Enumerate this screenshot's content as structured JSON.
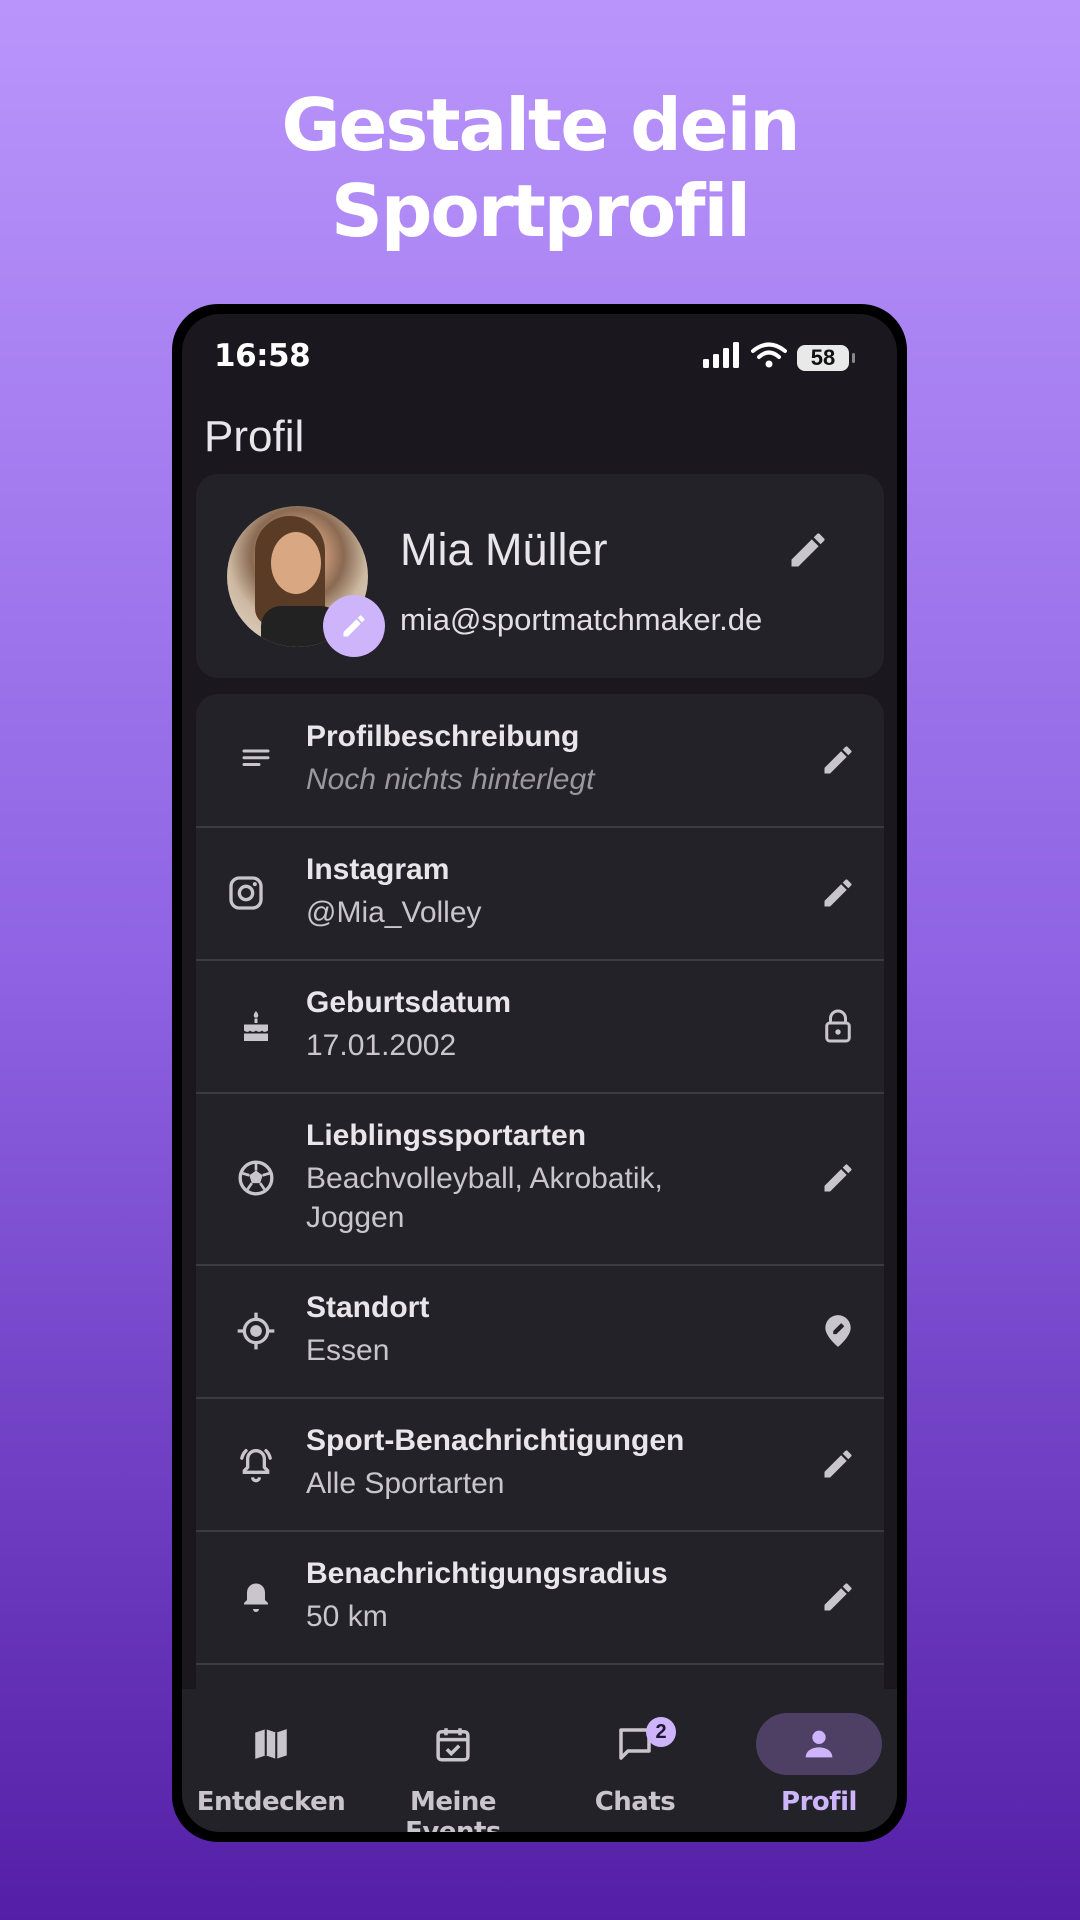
{
  "headline": {
    "line1": "Gestalte dein",
    "line2": "Sportprofil"
  },
  "status_bar": {
    "time": "16:58",
    "battery": "58"
  },
  "page_title": "Profil",
  "profile": {
    "name": "Mia Müller",
    "email": "mia@sportmatchmaker.de",
    "avatar_icon": "profile-photo",
    "avatar_edit_icon": "pencil-icon"
  },
  "rows": [
    {
      "icon": "notes-icon",
      "title": "Profilbeschreibung",
      "value": "Noch nichts hinterlegt",
      "action_icon": "pencil-icon"
    },
    {
      "icon": "instagram-icon",
      "title": "Instagram",
      "value": "@Mia_Volley",
      "action_icon": "pencil-icon"
    },
    {
      "icon": "cake-icon",
      "title": "Geburtsdatum",
      "value": "17.01.2002",
      "action_icon": "lock-icon"
    },
    {
      "icon": "soccer-ball-icon",
      "title": "Lieblingssportarten",
      "value": "Beachvolleyball, Akrobatik, Joggen",
      "action_icon": "pencil-icon"
    },
    {
      "icon": "location-target-icon",
      "title": "Standort",
      "value": "Essen",
      "action_icon": "location-edit-icon"
    },
    {
      "icon": "alarm-bell-icon",
      "title": "Sport-Benachrichtigungen",
      "value": "Alle Sportarten",
      "action_icon": "pencil-icon"
    },
    {
      "icon": "bell-icon",
      "title": "Benachrichtigungsradius",
      "value": "50 km",
      "action_icon": "pencil-icon"
    }
  ],
  "nav": [
    {
      "label": "Entdecken",
      "icon": "map-icon",
      "active": false
    },
    {
      "label": "Meine Events",
      "icon": "calendar-check-icon",
      "active": false
    },
    {
      "label": "Chats",
      "icon": "chat-icon",
      "badge": "2",
      "active": false
    },
    {
      "label": "Profil",
      "icon": "person-icon",
      "active": true
    }
  ],
  "colors": {
    "accent": "#cdb4fb",
    "surface": "#242229",
    "background": "#1a181e",
    "nav_active_pill": "#4e4065"
  }
}
